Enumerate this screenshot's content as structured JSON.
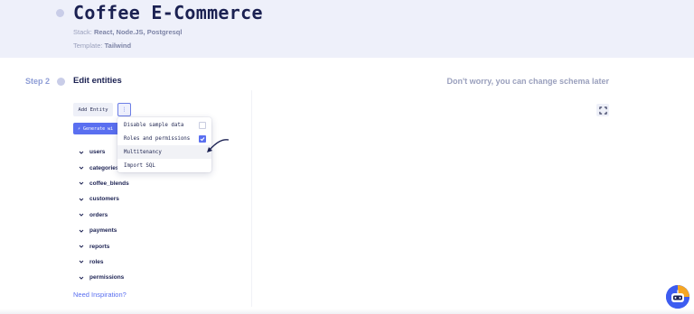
{
  "project": {
    "title": "Coffee E-Commerce",
    "stack_label": "Stack:",
    "stack_value": "React, Node.JS, Postgresql",
    "template_label": "Template:",
    "template_value": "Tailwind"
  },
  "step": {
    "label": "Step 2",
    "title": "Edit entities",
    "hint": "Don't worry, you can change schema later"
  },
  "toolbar": {
    "add_entity": "Add Entity",
    "more": "⋮",
    "generate": "⚡ Generate wi"
  },
  "dropdown": {
    "items": [
      {
        "label": "Disable sample data",
        "checked": false,
        "has_checkbox": true
      },
      {
        "label": "Roles and permissions",
        "checked": true,
        "has_checkbox": true
      },
      {
        "label": "Multitenancy",
        "checked": false,
        "has_checkbox": false
      },
      {
        "label": "Import SQL",
        "checked": false,
        "has_checkbox": false
      }
    ]
  },
  "entities": [
    "users",
    "categories",
    "coffee_blends",
    "customers",
    "orders",
    "payments",
    "reports",
    "roles",
    "permissions"
  ],
  "footer": {
    "inspiration": "Need Inspiration?"
  },
  "colors": {
    "accent": "#5a6ff0",
    "title": "#1b2152",
    "band": "#eef0fa"
  },
  "icons": {
    "expand": "expand-icon",
    "chevron": "chevron-down-icon",
    "assistant": "robot-assistant-icon"
  }
}
